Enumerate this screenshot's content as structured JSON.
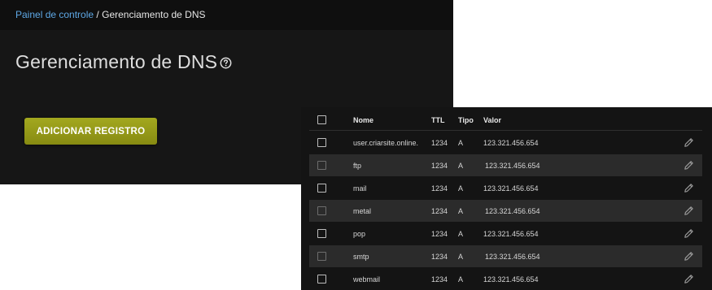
{
  "breadcrumb": {
    "home_label": "Painel de controle",
    "separator": "/",
    "current_label": "Gerenciamento de DNS"
  },
  "page": {
    "title": "Gerenciamento de DNS",
    "help_icon": "question-circle-icon"
  },
  "actions": {
    "add_record_label": "ADICIONAR REGISTRO"
  },
  "table": {
    "columns": {
      "name": "Nome",
      "ttl": "TTL",
      "type": "Tipo",
      "value": "Valor"
    },
    "rows": [
      {
        "name": "user.criarsite.online.",
        "ttl": "1234",
        "type": "A",
        "value": "123.321.456.654"
      },
      {
        "name": "ftp",
        "ttl": "1234",
        "type": "A",
        "value": "123.321.456.654"
      },
      {
        "name": "mail",
        "ttl": "1234",
        "type": "A",
        "value": "123.321.456.654"
      },
      {
        "name": "metal",
        "ttl": "1234",
        "type": "A",
        "value": "123.321.456.654"
      },
      {
        "name": "pop",
        "ttl": "1234",
        "type": "A",
        "value": "123.321.456.654"
      },
      {
        "name": "smtp",
        "ttl": "1234",
        "type": "A",
        "value": "123.321.456.654"
      },
      {
        "name": "webmail",
        "ttl": "1234",
        "type": "A",
        "value": "123.321.456.654"
      }
    ],
    "edit_icon": "pencil-icon"
  },
  "colors": {
    "panel_background": "#161616",
    "topbar_background": "#0f0f0f",
    "link": "#5ea8e6",
    "button_accent": "#9a9f1a",
    "table_background": "#141414",
    "row_alt_background": "#2b2b2b"
  }
}
